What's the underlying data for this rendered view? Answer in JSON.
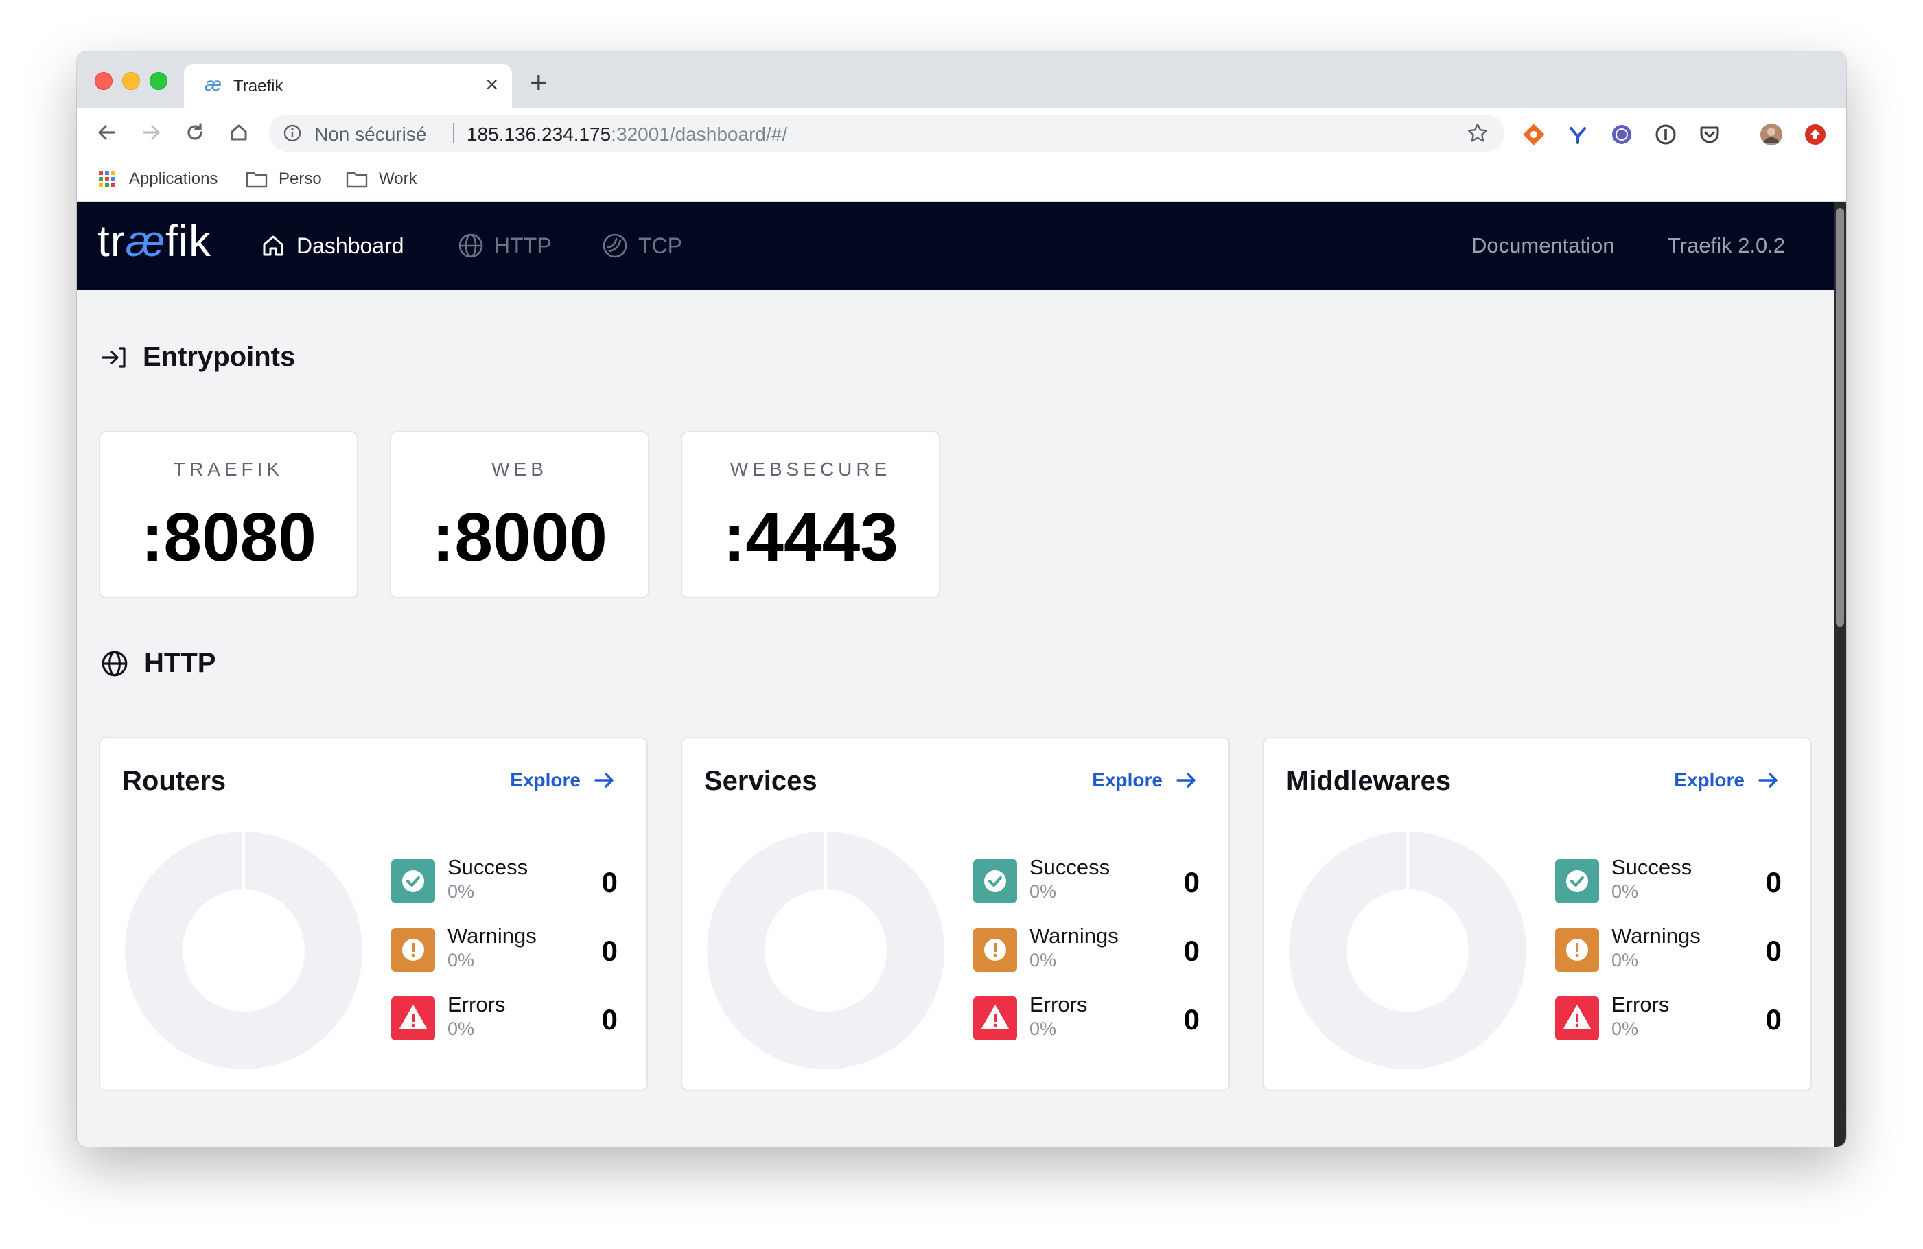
{
  "browser": {
    "tab_title": "Traefik",
    "tab_favicon": "æ",
    "new_tab_label": "+",
    "close_tab_label": "×",
    "security_label": "Non sécurisé",
    "url_host": "185.136.234.175",
    "url_rest": ":32001/dashboard/#/",
    "bookmarks": [
      "Applications",
      "Perso",
      "Work"
    ]
  },
  "nav": {
    "logo_prefix": "tr",
    "logo_ae": "æ",
    "logo_suffix": "fik",
    "items": [
      "Dashboard",
      "HTTP",
      "TCP"
    ],
    "documentation": "Documentation",
    "version": "Traefik 2.0.2"
  },
  "entrypoints": {
    "title": "Entrypoints",
    "cards": [
      {
        "name": "TRAEFIK",
        "port": ":8080"
      },
      {
        "name": "WEB",
        "port": ":8000"
      },
      {
        "name": "WEBSECURE",
        "port": ":4443"
      }
    ]
  },
  "http": {
    "title": "HTTP",
    "explore_label": "Explore",
    "cards": [
      {
        "title": "Routers",
        "stats": [
          {
            "label": "Success",
            "pct": "0%",
            "value": "0"
          },
          {
            "label": "Warnings",
            "pct": "0%",
            "value": "0"
          },
          {
            "label": "Errors",
            "pct": "0%",
            "value": "0"
          }
        ]
      },
      {
        "title": "Services",
        "stats": [
          {
            "label": "Success",
            "pct": "0%",
            "value": "0"
          },
          {
            "label": "Warnings",
            "pct": "0%",
            "value": "0"
          },
          {
            "label": "Errors",
            "pct": "0%",
            "value": "0"
          }
        ]
      },
      {
        "title": "Middlewares",
        "stats": [
          {
            "label": "Success",
            "pct": "0%",
            "value": "0"
          },
          {
            "label": "Warnings",
            "pct": "0%",
            "value": "0"
          },
          {
            "label": "Errors",
            "pct": "0%",
            "value": "0"
          }
        ]
      }
    ]
  },
  "colors": {
    "nav_bg": "#02081f",
    "success": "#4aa69a",
    "warning": "#da8a38",
    "error": "#ee3047",
    "link": "#1f5bd0",
    "donut": "#eff1f4"
  },
  "icons": {
    "entrypoints": "arrow-right-to-bracket-icon",
    "http": "globe-icon",
    "dashboard": "home-icon",
    "tcp": "tcp-icon",
    "success": "check-circle-icon",
    "warning": "exclamation-circle-icon",
    "error": "warning-triangle-icon"
  }
}
